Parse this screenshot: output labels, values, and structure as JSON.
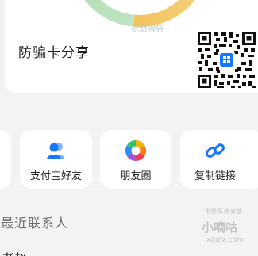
{
  "share_card": {
    "gauge_caption": "综合得分",
    "title": "防骗卡分享",
    "qr_badge_icon": "grid-app-icon"
  },
  "share_options": [
    {
      "label": "",
      "icon": "partial-icon"
    },
    {
      "label": "支付宝好友",
      "icon": "contacts-icon",
      "color": "#1677ff"
    },
    {
      "label": "朋友圈",
      "icon": "moments-shutter-icon"
    },
    {
      "label": "复制链接",
      "icon": "link-icon",
      "color": "#1677ff"
    }
  ],
  "recent_contacts": {
    "title": "最近联系人",
    "first_name": "老赵"
  },
  "watermark": {
    "top": "电脑系统安装",
    "main": "小嘀咕",
    "url": "xdgfz.com"
  },
  "colors": {
    "background": "#f3f3f4",
    "card": "#ffffff",
    "accent": "#1677ff"
  }
}
